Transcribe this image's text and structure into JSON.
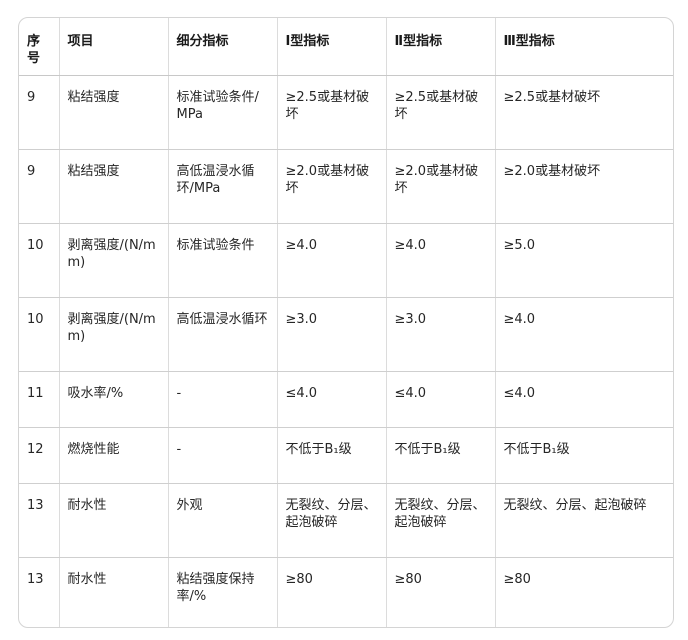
{
  "table": {
    "headers": [
      "序号",
      "项目",
      "细分指标",
      "Ⅰ型指标",
      "Ⅱ型指标",
      "Ⅲ型指标"
    ],
    "rows": [
      [
        "9",
        "粘结强度",
        "标准试验条件/MPa",
        "≥2.5或基材破坏",
        "≥2.5或基材破坏",
        "≥2.5或基材破坏"
      ],
      [
        "9",
        "粘结强度",
        "高低温浸水循环/MPa",
        "≥2.0或基材破坏",
        "≥2.0或基材破坏",
        "≥2.0或基材破坏"
      ],
      [
        "10",
        "剥离强度/(N/mm)",
        "标准试验条件",
        "≥4.0",
        "≥4.0",
        "≥5.0"
      ],
      [
        "10",
        "剥离强度/(N/mm)",
        "高低温浸水循环",
        "≥3.0",
        "≥3.0",
        "≥4.0"
      ],
      [
        "11",
        "吸水率/%",
        "-",
        "≤4.0",
        "≤4.0",
        "≤4.0"
      ],
      [
        "12",
        "燃烧性能",
        "-",
        "不低于B₁级",
        "不低于B₁级",
        "不低于B₁级"
      ],
      [
        "13",
        "耐水性",
        "外观",
        "无裂纹、分层、起泡破碎",
        "无裂纹、分层、起泡破碎",
        "无裂纹、分层、起泡破碎"
      ],
      [
        "13",
        "耐水性",
        "粘结强度保持率/%",
        "≥80",
        "≥80",
        "≥80"
      ]
    ]
  }
}
